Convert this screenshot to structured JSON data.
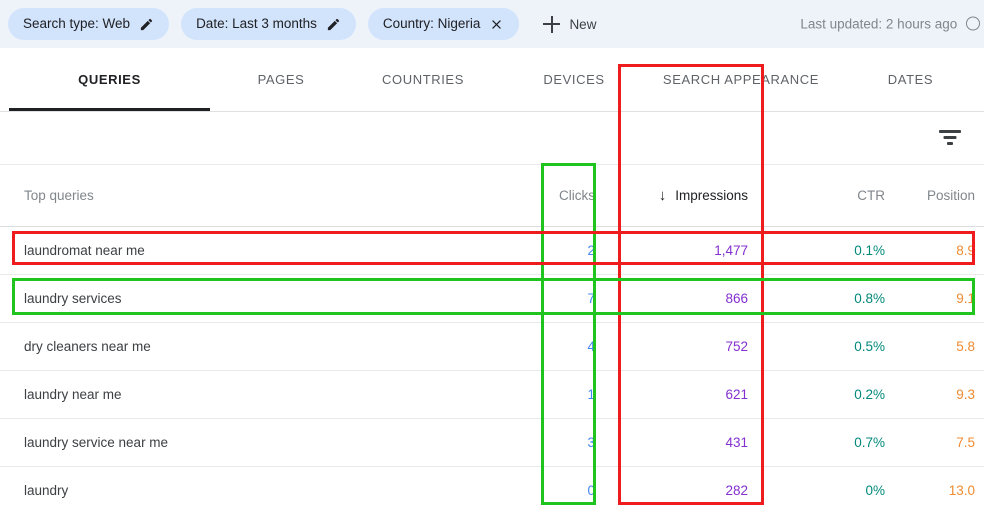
{
  "filter_bar": {
    "chips": [
      {
        "label": "Search type: Web",
        "icon": "pencil-icon",
        "name": "chip-search-type"
      },
      {
        "label": "Date: Last 3 months",
        "icon": "pencil-icon",
        "name": "chip-date"
      },
      {
        "label": "Country: Nigeria",
        "icon": "close-icon",
        "name": "chip-country"
      }
    ],
    "new_button": "New",
    "last_updated": "Last updated: 2 hours ago"
  },
  "tabs": [
    {
      "label": "QUERIES",
      "active": true
    },
    {
      "label": "PAGES",
      "active": false
    },
    {
      "label": "COUNTRIES",
      "active": false
    },
    {
      "label": "DEVICES",
      "active": false
    },
    {
      "label": "SEARCH APPEARANCE",
      "active": false
    },
    {
      "label": "DATES",
      "active": false
    }
  ],
  "toolbar": {
    "filter_icon": "filter-icon"
  },
  "table": {
    "headers": {
      "query": "Top queries",
      "clicks": "Clicks",
      "impressions": "Impressions",
      "ctr": "CTR",
      "position": "Position"
    },
    "sort": {
      "column": "impressions",
      "direction": "desc",
      "arrow": "↓"
    },
    "rows": [
      {
        "query": "laundromat near me",
        "clicks": "2",
        "impressions": "1,477",
        "ctr": "0.1%",
        "position": "8.9"
      },
      {
        "query": "laundry services",
        "clicks": "7",
        "impressions": "866",
        "ctr": "0.8%",
        "position": "9.1"
      },
      {
        "query": "dry cleaners near me",
        "clicks": "4",
        "impressions": "752",
        "ctr": "0.5%",
        "position": "5.8"
      },
      {
        "query": "laundry near me",
        "clicks": "1",
        "impressions": "621",
        "ctr": "0.2%",
        "position": "9.3"
      },
      {
        "query": "laundry service near me",
        "clicks": "3",
        "impressions": "431",
        "ctr": "0.7%",
        "position": "7.5"
      },
      {
        "query": "laundry",
        "clicks": "0",
        "impressions": "282",
        "ctr": "0%",
        "position": "13.0"
      }
    ]
  },
  "annotations": [
    {
      "name": "annotation-clicks-column",
      "color": "#1fc41f",
      "shape": "rectangle"
    },
    {
      "name": "annotation-impressions-column",
      "color": "#ee1c1c",
      "shape": "rectangle"
    },
    {
      "name": "annotation-row-laundromat-near-me",
      "color": "#ee1c1c",
      "shape": "rectangle"
    },
    {
      "name": "annotation-row-laundry-services",
      "color": "#1fc41f",
      "shape": "rectangle"
    }
  ],
  "colors": {
    "clicks": "#4285f4",
    "impressions": "#8430ce",
    "ctr": "#00897b",
    "position": "#ef8b32",
    "chip_bg": "#d2e3fc",
    "filter_bar_bg": "#eef3fa"
  }
}
